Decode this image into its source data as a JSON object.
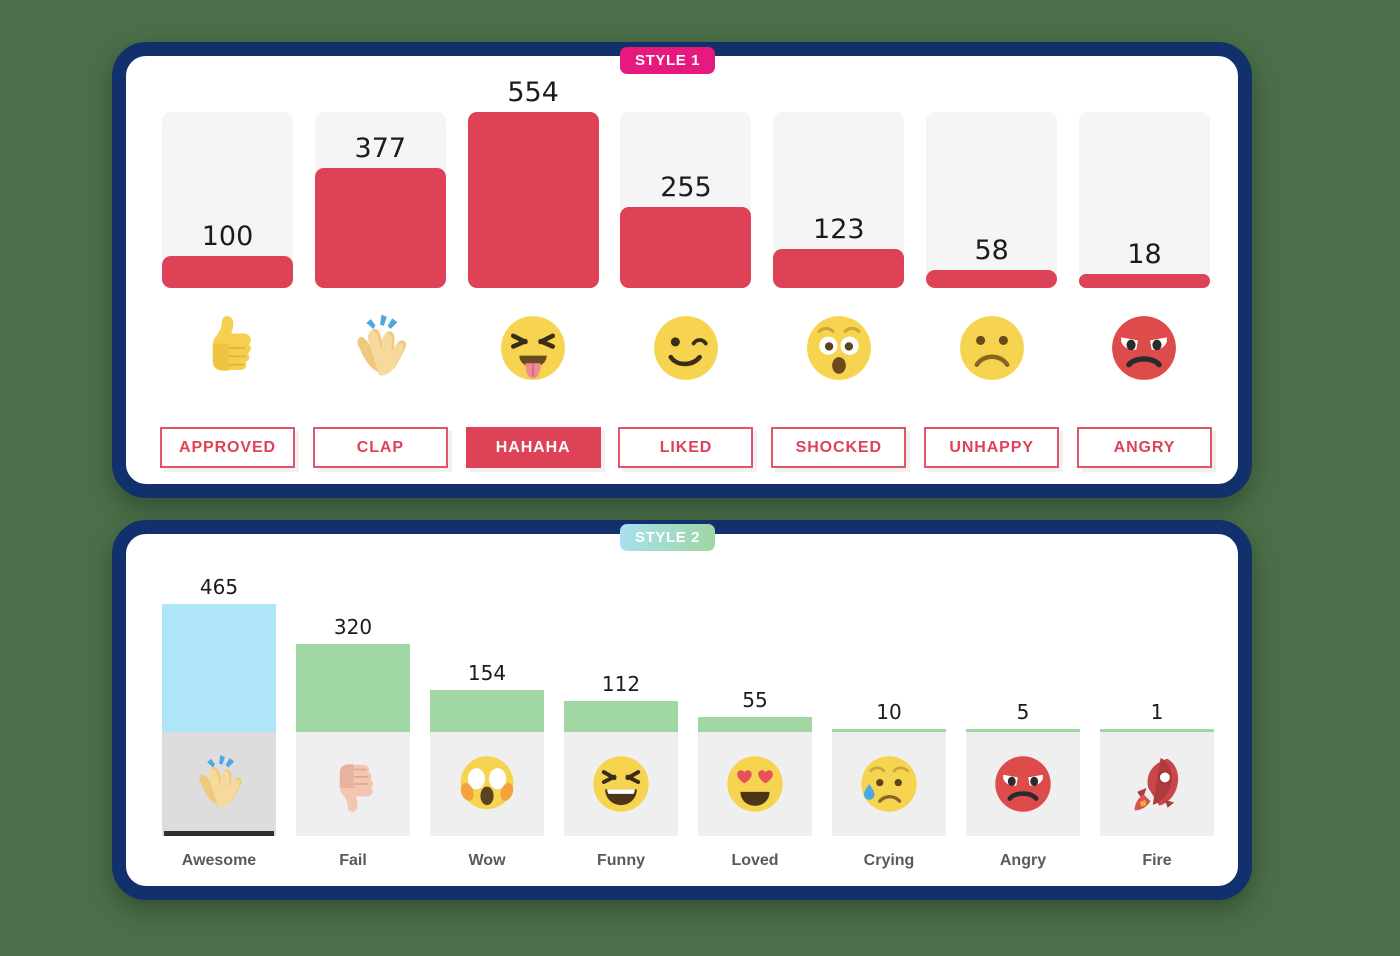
{
  "background_color": "#4b7049",
  "style1": {
    "badge_label": "STYLE 1",
    "badge_color": "#e6197e",
    "bar_color": "#de4256",
    "track_color": "#f5f5f6",
    "items": [
      {
        "value": 100,
        "label": "APPROVED",
        "emoji": "thumbs-up",
        "active": false
      },
      {
        "value": 377,
        "label": "CLAP",
        "emoji": "clapping-hands",
        "active": false
      },
      {
        "value": 554,
        "label": "HAHAHA",
        "emoji": "tongue-out-face",
        "active": true
      },
      {
        "value": 255,
        "label": "LIKED",
        "emoji": "winking-face",
        "active": false
      },
      {
        "value": 123,
        "label": "SHOCKED",
        "emoji": "astonished-face",
        "active": false
      },
      {
        "value": 58,
        "label": "UNHAPPY",
        "emoji": "frowning-face",
        "active": false
      },
      {
        "value": 18,
        "label": "ANGRY",
        "emoji": "angry-red-face",
        "active": false
      }
    ]
  },
  "style2": {
    "badge_label": "STYLE 2",
    "badge_gradient_from": "#a8dff0",
    "badge_gradient_to": "#9fd6a3",
    "bar_color": "#9fd6a3",
    "primary_bar_color": "#aee5f8",
    "items": [
      {
        "value": 465,
        "label": "Awesome",
        "emoji": "clapping-hands",
        "selected": true
      },
      {
        "value": 320,
        "label": "Fail",
        "emoji": "thumbs-down",
        "selected": false
      },
      {
        "value": 154,
        "label": "Wow",
        "emoji": "screaming-face",
        "selected": false
      },
      {
        "value": 112,
        "label": "Funny",
        "emoji": "laughing-squint-face",
        "selected": false
      },
      {
        "value": 55,
        "label": "Loved",
        "emoji": "heart-eyes-face",
        "selected": false
      },
      {
        "value": 10,
        "label": "Crying",
        "emoji": "crying-face",
        "selected": false
      },
      {
        "value": 5,
        "label": "Angry",
        "emoji": "angry-red-face",
        "selected": false
      },
      {
        "value": 1,
        "label": "Fire",
        "emoji": "rocket",
        "selected": false
      }
    ]
  },
  "chart_data": [
    {
      "type": "bar",
      "title": "STYLE 1",
      "categories": [
        "APPROVED",
        "CLAP",
        "HAHAHA",
        "LIKED",
        "SHOCKED",
        "UNHAPPY",
        "ANGRY"
      ],
      "values": [
        100,
        377,
        554,
        255,
        123,
        58,
        18
      ],
      "xlabel": "",
      "ylabel": "",
      "ylim": [
        0,
        554
      ],
      "grid": false,
      "legend": "none",
      "bar_color": "#de4256",
      "track_color": "#f5f5f6",
      "highlighted_category": "HAHAHA"
    },
    {
      "type": "bar",
      "title": "STYLE 2",
      "categories": [
        "Awesome",
        "Fail",
        "Wow",
        "Funny",
        "Loved",
        "Crying",
        "Angry",
        "Fire"
      ],
      "values": [
        465,
        320,
        154,
        112,
        55,
        10,
        5,
        1
      ],
      "xlabel": "",
      "ylabel": "",
      "ylim": [
        0,
        465
      ],
      "grid": false,
      "legend": "none",
      "bar_color": "#9fd6a3",
      "highlighted_category": "Awesome",
      "highlight_color": "#aee5f8"
    }
  ]
}
